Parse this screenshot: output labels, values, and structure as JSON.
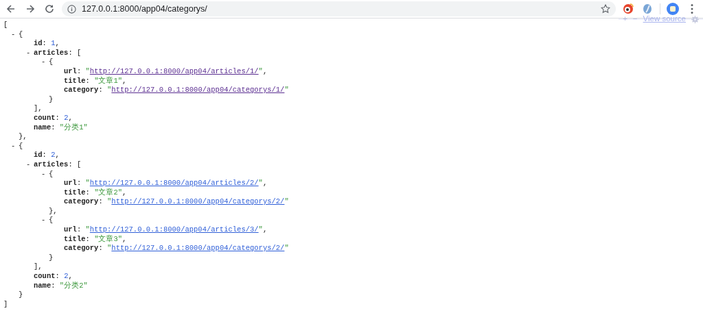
{
  "browser": {
    "address": "127.0.0.1:8000/app04/categorys/"
  },
  "viewer_toolbar": {
    "expand": "+",
    "collapse": "−",
    "view_source": "View source"
  },
  "document": {
    "kind": "container",
    "open": "[",
    "close": "]",
    "children": [
      {
        "kind": "container",
        "toggle": "-",
        "open": "{",
        "close": "}",
        "comma": ",",
        "children": [
          {
            "kind": "number",
            "key": "id",
            "colon": ":",
            "value": "1",
            "comma": ","
          },
          {
            "kind": "container",
            "toggle": "-",
            "key": "articles",
            "colon": ":",
            "open": "[",
            "close": "]",
            "comma": ",",
            "children": [
              {
                "kind": "container",
                "toggle": "-",
                "open": "{",
                "close": "}",
                "children": [
                  {
                    "kind": "link",
                    "key": "url",
                    "colon": ":",
                    "quote": "\"",
                    "value": "http://127.0.0.1:8000/app04/articles/1/",
                    "visited": true,
                    "comma": ","
                  },
                  {
                    "kind": "string",
                    "key": "title",
                    "colon": ":",
                    "quote": "\"",
                    "value": "文章1",
                    "comma": ","
                  },
                  {
                    "kind": "link",
                    "key": "category",
                    "colon": ":",
                    "quote": "\"",
                    "value": "http://127.0.0.1:8000/app04/categorys/1/",
                    "visited": true
                  }
                ]
              }
            ]
          },
          {
            "kind": "number",
            "key": "count",
            "colon": ":",
            "value": "2",
            "comma": ","
          },
          {
            "kind": "string",
            "key": "name",
            "colon": ":",
            "quote": "\"",
            "value": "分类1"
          }
        ]
      },
      {
        "kind": "container",
        "toggle": "-",
        "open": "{",
        "close": "}",
        "children": [
          {
            "kind": "number",
            "key": "id",
            "colon": ":",
            "value": "2",
            "comma": ","
          },
          {
            "kind": "container",
            "toggle": "-",
            "key": "articles",
            "colon": ":",
            "open": "[",
            "close": "]",
            "comma": ",",
            "children": [
              {
                "kind": "container",
                "toggle": "-",
                "open": "{",
                "close": "}",
                "comma": ",",
                "children": [
                  {
                    "kind": "link",
                    "key": "url",
                    "colon": ":",
                    "quote": "\"",
                    "value": "http://127.0.0.1:8000/app04/articles/2/",
                    "visited": false,
                    "comma": ","
                  },
                  {
                    "kind": "string",
                    "key": "title",
                    "colon": ":",
                    "quote": "\"",
                    "value": "文章2",
                    "comma": ","
                  },
                  {
                    "kind": "link",
                    "key": "category",
                    "colon": ":",
                    "quote": "\"",
                    "value": "http://127.0.0.1:8000/app04/categorys/2/",
                    "visited": false
                  }
                ]
              },
              {
                "kind": "container",
                "toggle": "-",
                "open": "{",
                "close": "}",
                "children": [
                  {
                    "kind": "link",
                    "key": "url",
                    "colon": ":",
                    "quote": "\"",
                    "value": "http://127.0.0.1:8000/app04/articles/3/",
                    "visited": false,
                    "comma": ","
                  },
                  {
                    "kind": "string",
                    "key": "title",
                    "colon": ":",
                    "quote": "\"",
                    "value": "文章3",
                    "comma": ","
                  },
                  {
                    "kind": "link",
                    "key": "category",
                    "colon": ":",
                    "quote": "\"",
                    "value": "http://127.0.0.1:8000/app04/categorys/2/",
                    "visited": false
                  }
                ]
              }
            ]
          },
          {
            "kind": "number",
            "key": "count",
            "colon": ":",
            "value": "2",
            "comma": ","
          },
          {
            "kind": "string",
            "key": "name",
            "colon": ":",
            "quote": "\"",
            "value": "分类2"
          }
        ]
      }
    ]
  }
}
